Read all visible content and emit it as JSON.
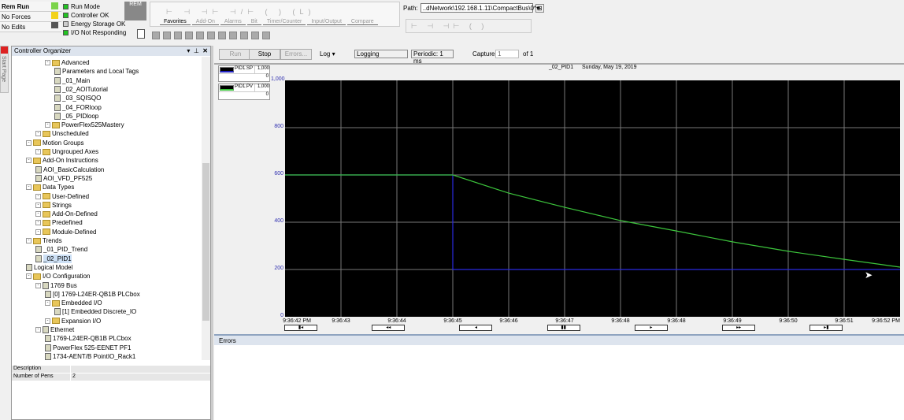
{
  "status": {
    "mode": "Rem Run",
    "forces": "No Forces",
    "edits": "No Edits"
  },
  "indicators": [
    {
      "label": "Run Mode",
      "color": "#22c322"
    },
    {
      "label": "Controller OK",
      "color": "#22c322"
    },
    {
      "label": "Energy Storage OK",
      "color": "#cccccc"
    },
    {
      "label": "I/O Not Responding",
      "color": "#22c322"
    }
  ],
  "key_label": "REM",
  "instruction_tabs": [
    "Favorites",
    "Add-On",
    "Alarms",
    "Bit",
    "Timer/Counter",
    "Input/Output",
    "Compare"
  ],
  "path": {
    "label": "Path:",
    "value": "..dNetwork\\192.168.1.11\\CompactBus\\0*"
  },
  "organizer": {
    "title": "Controller Organizer",
    "side_tab": "Start Page",
    "tree": [
      {
        "label": "Advanced",
        "level": 2,
        "icon": "folder"
      },
      {
        "label": "Parameters and Local Tags",
        "level": 3,
        "icon": "tags"
      },
      {
        "label": "_01_Main",
        "level": 3,
        "icon": "routine"
      },
      {
        "label": "_02_AOITutorial",
        "level": 3,
        "icon": "routine"
      },
      {
        "label": "_03_SQISQO",
        "level": 3,
        "icon": "routine"
      },
      {
        "label": "_04_FORloop",
        "level": 3,
        "icon": "routine"
      },
      {
        "label": "_05_PIDloop",
        "level": 3,
        "icon": "routine"
      },
      {
        "label": "PowerFlex525Mastery",
        "level": 2,
        "icon": "folder"
      },
      {
        "label": "Unscheduled",
        "level": 1,
        "icon": "folder"
      },
      {
        "label": "Motion Groups",
        "level": 0,
        "icon": "folder"
      },
      {
        "label": "Ungrouped Axes",
        "level": 1,
        "icon": "folder"
      },
      {
        "label": "Add-On Instructions",
        "level": 0,
        "icon": "folder"
      },
      {
        "label": "AOI_BasicCalculation",
        "level": 1,
        "icon": "aoi"
      },
      {
        "label": "AOI_VFD_PF525",
        "level": 1,
        "icon": "aoi"
      },
      {
        "label": "Data Types",
        "level": 0,
        "icon": "folder"
      },
      {
        "label": "User-Defined",
        "level": 1,
        "icon": "folder"
      },
      {
        "label": "Strings",
        "level": 1,
        "icon": "folder"
      },
      {
        "label": "Add-On-Defined",
        "level": 1,
        "icon": "folder"
      },
      {
        "label": "Predefined",
        "level": 1,
        "icon": "folder"
      },
      {
        "label": "Module-Defined",
        "level": 1,
        "icon": "folder"
      },
      {
        "label": "Trends",
        "level": 0,
        "icon": "folder"
      },
      {
        "label": "_01_PID_Trend",
        "level": 1,
        "icon": "trend"
      },
      {
        "label": "_02_PID1",
        "level": 1,
        "icon": "trend",
        "selected": true
      },
      {
        "label": "Logical Model",
        "level": 0,
        "icon": "model"
      },
      {
        "label": "I/O Configuration",
        "level": 0,
        "icon": "folder"
      },
      {
        "label": "1769 Bus",
        "level": 1,
        "icon": "bus"
      },
      {
        "label": "[0] 1769-L24ER-QB1B PLCbox",
        "level": 2,
        "icon": "module"
      },
      {
        "label": "Embedded I/O",
        "level": 2,
        "icon": "folder"
      },
      {
        "label": "[1] Embedded Discrete_IO",
        "level": 3,
        "icon": "module"
      },
      {
        "label": "Expansion I/O",
        "level": 2,
        "icon": "folder"
      },
      {
        "label": "Ethernet",
        "level": 1,
        "icon": "network"
      },
      {
        "label": "1769-L24ER-QB1B PLCbox",
        "level": 2,
        "icon": "module"
      },
      {
        "label": "PowerFlex 525-EENET PF1",
        "level": 2,
        "icon": "drive"
      },
      {
        "label": "1734-AENT/B PointIO_Rack1",
        "level": 2,
        "icon": "module"
      }
    ],
    "properties": [
      {
        "name": "Description",
        "value": ""
      },
      {
        "name": "Number of Pens",
        "value": "2"
      }
    ]
  },
  "trend_toolbar": {
    "run": "Run",
    "stop": "Stop",
    "errors": "Errors...",
    "log": "Log ▾",
    "logging": "Logging",
    "periodic": "Periodic: 1 ms",
    "capture_label": "Capture:",
    "capture_value": "1",
    "capture_of": "of 1"
  },
  "pens": [
    {
      "name": "PID1.SP",
      "max": "1,000",
      "min": "0",
      "color": "#2020c0"
    },
    {
      "name": "PID1.PV",
      "max": "1,000",
      "min": "0",
      "color": "#3cc43c"
    }
  ],
  "chart_header": {
    "name": "_02_PID1",
    "date": "Sunday, May 19, 2019"
  },
  "errors_panel": {
    "title": "Errors"
  },
  "chart_data": {
    "type": "line",
    "title": "_02_PID1",
    "xlabel": "",
    "ylabel": "",
    "ylim": [
      0,
      1000
    ],
    "yticks": [
      "0",
      "200",
      "400",
      "600",
      "800",
      "1,000"
    ],
    "ytick_values": [
      0,
      200,
      400,
      600,
      800,
      1000
    ],
    "xlim": [
      0,
      11
    ],
    "xtick_labels": [
      "9:36:42 PM",
      "9:36:43",
      "9:36:44",
      "9:36:45",
      "9:36:46",
      "9:36:47",
      "9:36:48",
      "9:36:48",
      "9:36:49",
      "9:36:50",
      "9:36:51",
      "9:36:52 PM"
    ],
    "grid": true,
    "legend": "top-left",
    "series": [
      {
        "name": "PID1.SP",
        "color": "#2a2ae0",
        "x": [
          0,
          3,
          3,
          11
        ],
        "y": [
          600,
          600,
          200,
          200
        ]
      },
      {
        "name": "PID1.PV",
        "color": "#3cc43c",
        "x": [
          0,
          3,
          4,
          5,
          6,
          7,
          8,
          9,
          10,
          11
        ],
        "y": [
          600,
          600,
          523,
          463,
          407,
          363,
          317,
          277,
          243,
          210
        ]
      }
    ]
  },
  "nav_buttons": [
    "▮◂",
    "◂◂",
    "◂",
    "▮▮",
    "▸",
    "▸▸",
    "▸▮"
  ]
}
